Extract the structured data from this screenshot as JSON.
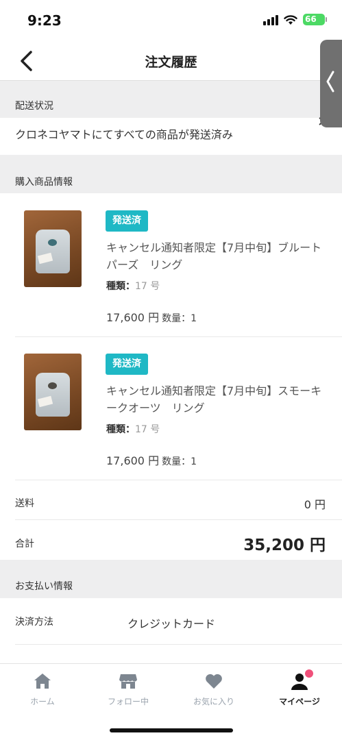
{
  "status": {
    "time": "9:23",
    "battery": "66"
  },
  "nav": {
    "title": "注文履歴"
  },
  "shipping": {
    "header": "配送状況",
    "status_text": "クロネコヤマトにてすべての商品が発送済み"
  },
  "purchase": {
    "header": "購入商品情報",
    "items": [
      {
        "badge": "発送済",
        "name": "キャンセル通知者限定【7月中旬】ブルートパーズ　リング",
        "variant_label": "種類：",
        "variant_value": "17 号",
        "price": "17,600 円",
        "quantity": "数量：1"
      },
      {
        "badge": "発送済",
        "name": "キャンセル通知者限定【7月中旬】スモーキークオーツ　リング",
        "variant_label": "種類：",
        "variant_value": "17 号",
        "price": "17,600 円",
        "quantity": "数量：1"
      }
    ]
  },
  "summary": {
    "shipping_label": "送料",
    "shipping_value": "0 円",
    "total_label": "合計",
    "total_value": "35,200 円"
  },
  "payment": {
    "header": "お支払い情報",
    "method_label": "決済方法",
    "method_value": "クレジットカード"
  },
  "tabbar": {
    "active": "マイページ",
    "items": [
      {
        "label": "ホーム",
        "icon": "home-icon"
      },
      {
        "label": "フォロー中",
        "icon": "store-icon"
      },
      {
        "label": "お気に入り",
        "icon": "heart-icon"
      },
      {
        "label": "マイページ",
        "icon": "user-icon"
      }
    ]
  },
  "colors": {
    "accent": "#1fb8c5",
    "section_bg": "#eeeeef",
    "notify": "#f0507a",
    "battery": "#4cd964"
  }
}
